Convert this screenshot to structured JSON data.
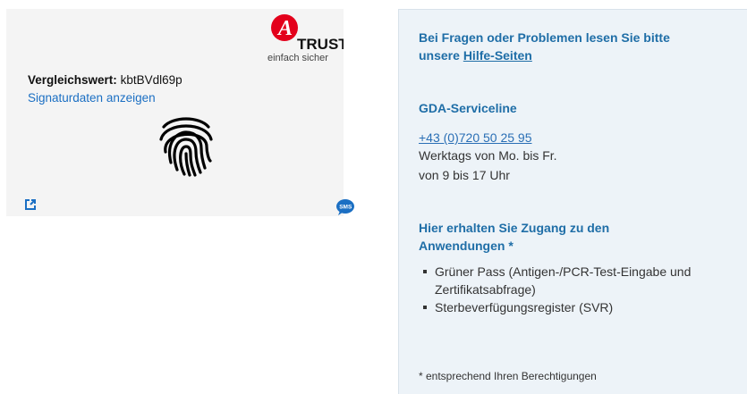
{
  "logo": {
    "letter": "A",
    "word": "TRUST",
    "tagline": "einfach sicher",
    "brand_color": "#e3001b"
  },
  "signature": {
    "compare_label": "Vergleichswert:",
    "compare_value": "kbtBVdl69p",
    "show_link": "Signaturdaten anzeigen",
    "fingerprint_icon": "fingerprint-icon",
    "external_icon": "external-link-icon",
    "sms_icon": "sms-icon",
    "sms_text": "SMS"
  },
  "help": {
    "intro": "Bei Fragen oder Problemen lesen Sie bitte unsere",
    "link": "Hilfe-Seiten",
    "serviceline_title": "GDA-Serviceline",
    "phone": "+43 (0)720 50 25 95",
    "hours_days": "Werktags von Mo. bis Fr.",
    "hours_time": "von 9 bis 17 Uhr",
    "access_title": "Hier erhalten Sie Zugang zu den Anwendungen *",
    "apps": [
      "Grüner Pass (Antigen-/PCR-Test-Eingabe und Zertifikatsabfrage)",
      "Sterbeverfügungsregister (SVR)"
    ],
    "footnote": "* entsprechend Ihren Berechtigungen"
  },
  "colors": {
    "accent_blue": "#1f6ea7",
    "link_blue": "#1b6fc3",
    "panel_bg": "#edf3f8"
  }
}
